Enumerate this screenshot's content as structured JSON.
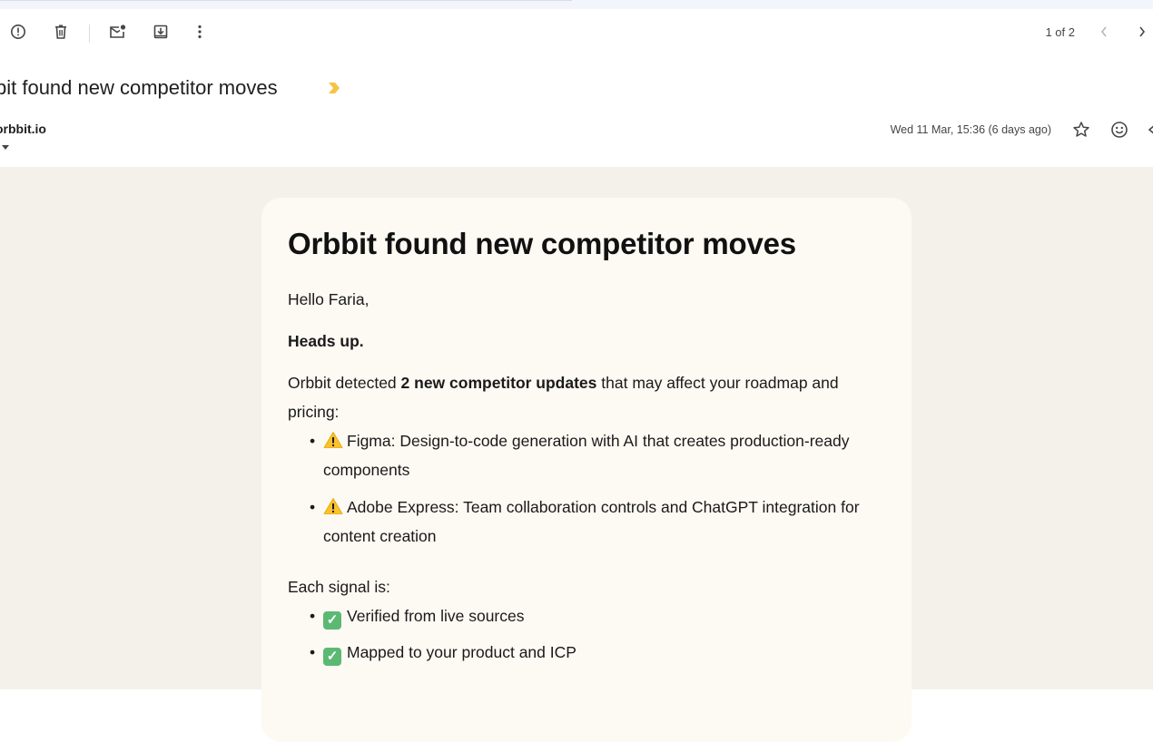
{
  "toolbar": {
    "pager_text": "1 of 2"
  },
  "message": {
    "subject": "bit found new competitor moves",
    "sender": "orbbit.io",
    "date": "Wed 11 Mar, 15:36 (6 days ago)"
  },
  "email": {
    "title": "Orbbit found new competitor moves",
    "greeting": "Hello Faria,",
    "heads_up": "Heads up.",
    "intro_prefix": "Orbbit detected ",
    "intro_bold": "2 new competitor updates",
    "intro_suffix": " that may affect your roadmap and pricing:",
    "updates": [
      "Figma: Design-to-code generation with AI that creates production-ready components",
      "Adobe Express: Team collaboration controls and ChatGPT integration for content creation"
    ],
    "signal_intro": "Each signal is:",
    "signal_points": [
      "Verified from live sources",
      "Mapped to your product and ICP"
    ]
  },
  "colors": {
    "email_background": "#f4f1ea",
    "card_background": "#fdf9f3",
    "importance_marker": "#f6c344",
    "check_green": "#5bb974",
    "warning_yellow": "#f9c22e"
  },
  "icons": {
    "toolbar": [
      "report-spam-icon",
      "delete-icon",
      "mark-unread-icon",
      "move-to-icon",
      "more-vert-icon"
    ],
    "navigation": [
      "chevron-left-icon",
      "chevron-right-icon"
    ],
    "header": [
      "star-icon",
      "emoji-react-icon"
    ]
  }
}
